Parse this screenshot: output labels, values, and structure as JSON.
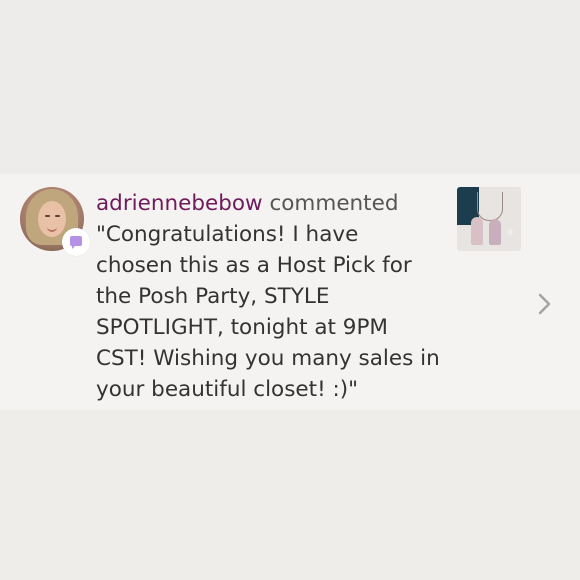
{
  "notification": {
    "username": "adriennebebow",
    "action": "commented",
    "comment": "\"Congratulations! I have chosen this as a Host Pick for the Posh Party, STYLE SPOTLIGHT, tonight at 9PM CST! Wishing you many sales in your beautiful closet! :)\""
  },
  "icons": {
    "badge": "comment-bubble-icon",
    "navigation": "chevron-right-icon"
  },
  "colors": {
    "username": "#6f1a5a",
    "badge_accent": "#b592e4",
    "row_background": "#f4f3f1",
    "page_background": "#eeedea"
  }
}
